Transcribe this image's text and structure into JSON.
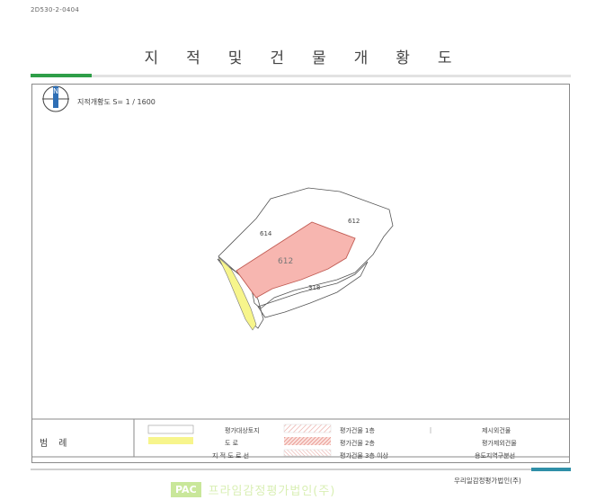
{
  "document": {
    "id": "2D530-2-0404",
    "title": "지적및건물개황도"
  },
  "map": {
    "scale_label": "지적개황도 S= 1 / 1600",
    "parcels": {
      "subject": "612",
      "north_east": "612",
      "north_west": "614",
      "south": "318"
    }
  },
  "legend": {
    "title": "범례",
    "items": {
      "subject_land": "평가대상토지",
      "road": "도     로",
      "boundary": "지 적 도 로 선",
      "building_1f": "평가건물 1층",
      "building_2f": "평가건물 2층",
      "building_3f": "평가건물 3층 이상",
      "other_building": "제시외건물",
      "excluded_building": "평가제외건물",
      "district": "용도지역구분선"
    }
  },
  "footer": {
    "company": "우리일감정평가법인(주)",
    "watermark_logo": "PAC",
    "watermark_text": "프라임감정평가법인(주)"
  },
  "colors": {
    "subject_fill": "#f7b6b0",
    "road_fill": "#f7f58c",
    "accent_green": "#2e9e48",
    "accent_teal": "#2f8fa8",
    "hatch": "#e8a39d"
  }
}
